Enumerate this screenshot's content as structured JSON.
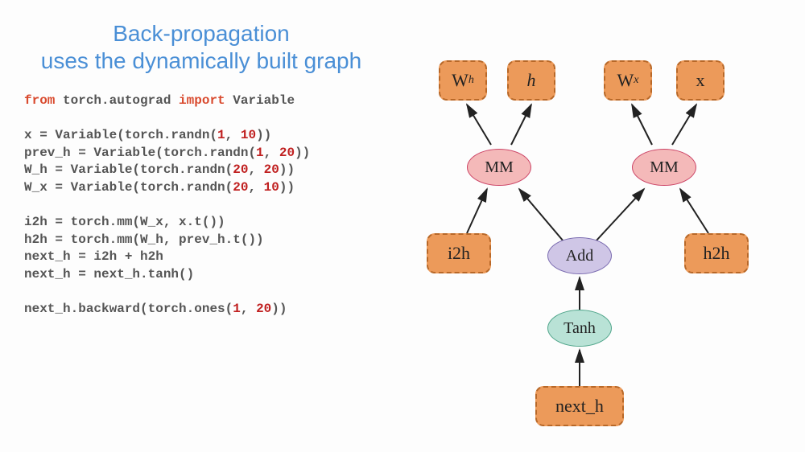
{
  "title_line1": "Back-propagation",
  "title_line2": "uses the dynamically built graph",
  "code": {
    "kw_from": "from",
    "mod": " torch.autograd ",
    "kw_import": "import",
    "imp": " Variable",
    "l1a": "x = Variable(torch.randn(",
    "n1a": "1",
    "c": ", ",
    "n1b": "10",
    "rp": "))",
    "l2a": "prev_h = Variable(torch.randn(",
    "n2a": "1",
    "n2b": "20",
    "l3a": "W_h = Variable(torch.randn(",
    "n3a": "20",
    "n3b": "20",
    "l4a": "W_x = Variable(torch.randn(",
    "n4a": "20",
    "n4b": "10",
    "l5": "i2h = torch.mm(W_x, x.t())",
    "l6": "h2h = torch.mm(W_h, prev_h.t())",
    "l7": "next_h = i2h + h2h",
    "l8": "next_h = next_h.tanh()",
    "l9a": "next_h.backward(torch.ones(",
    "n9a": "1",
    "n9b": "20"
  },
  "nodes": {
    "Wh_label": "W",
    "Wh_sub": "h",
    "h_label": "h",
    "Wx_label": "W",
    "Wx_sub": "x",
    "x_label": "x",
    "mm1": "MM",
    "mm2": "MM",
    "i2h": "i2h",
    "add": "Add",
    "h2h": "h2h",
    "tanh": "Tanh",
    "next_h": "next_h"
  }
}
